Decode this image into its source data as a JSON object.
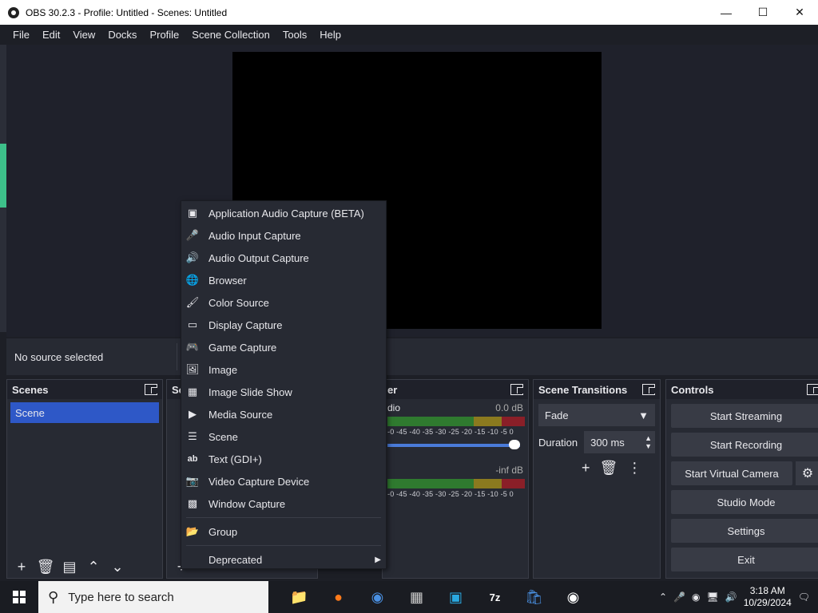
{
  "window": {
    "title": "OBS 30.2.3 - Profile: Untitled - Scenes: Untitled"
  },
  "menubar": [
    "File",
    "Edit",
    "View",
    "Docks",
    "Profile",
    "Scene Collection",
    "Tools",
    "Help"
  ],
  "source_bar": {
    "status": "No source selected"
  },
  "docks": {
    "scenes": {
      "title": "Scenes",
      "items": [
        "Scene"
      ]
    },
    "sources": {
      "title": "So"
    },
    "mixer": {
      "title": "er",
      "channels": [
        {
          "name": "dio",
          "db": "0.0 dB"
        },
        {
          "name": "",
          "db": "-inf dB"
        }
      ],
      "scale": "-0 -45 -40 -35 -30 -25 -20 -15 -10 -5 0"
    },
    "transitions": {
      "title": "Scene Transitions",
      "selected": "Fade",
      "duration_label": "Duration",
      "duration_value": "300 ms"
    },
    "controls": {
      "title": "Controls",
      "buttons": [
        "Start Streaming",
        "Start Recording",
        "Start Virtual Camera",
        "Studio Mode",
        "Settings",
        "Exit"
      ]
    }
  },
  "context_menu": {
    "items": [
      {
        "label": "Application Audio Capture (BETA)",
        "icon": "app-audio-icon"
      },
      {
        "label": "Audio Input Capture",
        "icon": "microphone-icon"
      },
      {
        "label": "Audio Output Capture",
        "icon": "speaker-icon"
      },
      {
        "label": "Browser",
        "icon": "globe-icon"
      },
      {
        "label": "Color Source",
        "icon": "paintbrush-icon"
      },
      {
        "label": "Display Capture",
        "icon": "monitor-icon"
      },
      {
        "label": "Game Capture",
        "icon": "gamepad-icon"
      },
      {
        "label": "Image",
        "icon": "image-icon"
      },
      {
        "label": "Image Slide Show",
        "icon": "slideshow-icon"
      },
      {
        "label": "Media Source",
        "icon": "play-icon"
      },
      {
        "label": "Scene",
        "icon": "list-icon"
      },
      {
        "label": "Text (GDI+)",
        "icon": "text-icon"
      },
      {
        "label": "Video Capture Device",
        "icon": "camera-icon"
      },
      {
        "label": "Window Capture",
        "icon": "window-icon"
      }
    ],
    "group": {
      "label": "Group",
      "icon": "folder-icon"
    },
    "deprecated": {
      "label": "Deprecated",
      "icon": ""
    }
  },
  "taskbar": {
    "search_placeholder": "Type here to search",
    "time": "3:18 AM",
    "date": "10/29/2024"
  }
}
